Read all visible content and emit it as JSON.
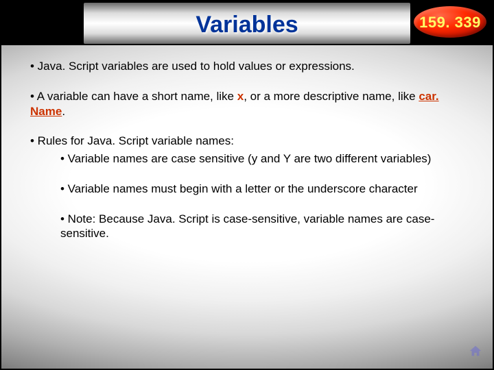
{
  "header": {
    "title": "Variables",
    "badge": "159. 339"
  },
  "body": {
    "p1_a": " • Java. Script variables are used to hold values or expressions.",
    "p2_a": " • A variable can have a short name, like ",
    "p2_x": "x",
    "p2_b": ", or a more descriptive name, like ",
    "p2_car": "car. Name",
    "p2_c": ".",
    "p3": " • Rules for Java. Script variable names:",
    "s1": " • Variable names are case sensitive (y and Y are two different variables)",
    "s2": " • Variable names must begin with a letter or the underscore character",
    "s3": " • Note: Because Java. Script is case-sensitive, variable names are case-sensitive."
  }
}
